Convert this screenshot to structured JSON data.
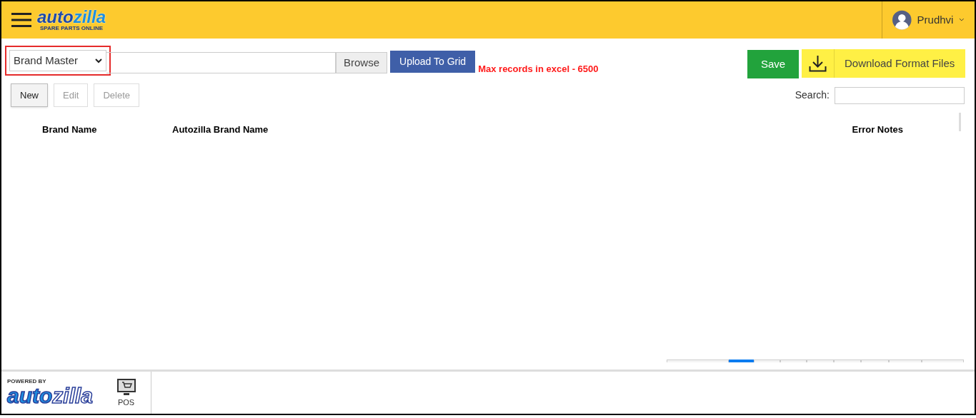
{
  "header": {
    "logo": {
      "word_a": "auto",
      "word_b": "zilla",
      "tagline": "SPARE PARTS ONLINE"
    },
    "user": "Prudhvi"
  },
  "toolbar": {
    "master_select": "Brand Master",
    "browse": "Browse",
    "upload": "Upload To Grid",
    "note": "Max records in excel - 6500",
    "save": "Save",
    "download": "Download Format Files"
  },
  "actions": [
    {
      "label": "New",
      "disabled": false
    },
    {
      "label": "Edit",
      "disabled": true
    },
    {
      "label": "Delete",
      "disabled": true
    }
  ],
  "search": {
    "label": "Search:"
  },
  "table": {
    "columns": [
      "Brand Name",
      "Autozilla Brand Name",
      "Error Notes"
    ]
  },
  "pager": [
    {
      "selected": false
    },
    {
      "selected": true
    },
    {
      "selected": false
    },
    {
      "selected": false
    },
    {
      "selected": false
    },
    {
      "selected": false
    },
    {
      "selected": false
    },
    {
      "selected": false
    },
    {
      "selected": false
    }
  ],
  "footer": {
    "powered": "POWERED BY",
    "logo_a": "auto",
    "logo_b": "zilla",
    "pos": "POS"
  }
}
